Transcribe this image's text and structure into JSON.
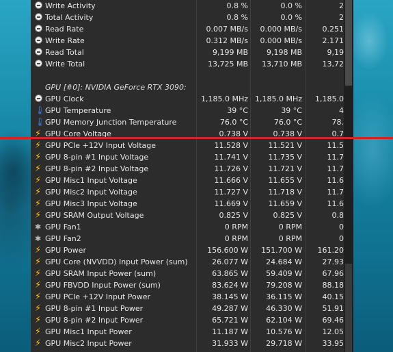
{
  "rows": [
    {
      "icon": "clock",
      "label": "Write Activity",
      "c1": "0.8 %",
      "c2": "0.0 %",
      "c3": "2"
    },
    {
      "icon": "clock",
      "label": "Total Activity",
      "c1": "0.8 %",
      "c2": "0.0 %",
      "c3": "2"
    },
    {
      "icon": "clock",
      "label": "Read Rate",
      "c1": "0.007 MB/s",
      "c2": "0.000 MB/s",
      "c3": "0.251"
    },
    {
      "icon": "clock",
      "label": "Write Rate",
      "c1": "0.312 MB/s",
      "c2": "0.000 MB/s",
      "c3": "2.171"
    },
    {
      "icon": "clock",
      "label": "Read Total",
      "c1": "9,199 MB",
      "c2": "9,198 MB",
      "c3": "9,19"
    },
    {
      "icon": "clock",
      "label": "Write Total",
      "c1": "13,725 MB",
      "c2": "13,710 MB",
      "c3": "13,72"
    },
    {
      "icon": "none",
      "label": "",
      "c1": "",
      "c2": "",
      "c3": ""
    },
    {
      "icon": "none",
      "label": "GPU [#0]: NVIDIA GeForce RTX 3090:",
      "c1": "",
      "c2": "",
      "c3": "",
      "section": true
    },
    {
      "icon": "clock",
      "label": "GPU Clock",
      "c1": "1,185.0 MHz",
      "c2": "1,185.0 MHz",
      "c3": "1,185.0"
    },
    {
      "icon": "therm",
      "label": "GPU Temperature",
      "c1": "39 °C",
      "c2": "39 °C",
      "c3": "4"
    },
    {
      "icon": "therm",
      "label": "GPU Memory Junction Temperature",
      "c1": "76.0 °C",
      "c2": "76.0 °C",
      "c3": "78."
    },
    {
      "icon": "bolt",
      "label": "GPU Core Voltage",
      "c1": "0.738 V",
      "c2": "0.738 V",
      "c3": "0.7"
    },
    {
      "icon": "bolt",
      "label": "GPU PCIe +12V Input Voltage",
      "c1": "11.528 V",
      "c2": "11.521 V",
      "c3": "11.5"
    },
    {
      "icon": "bolt",
      "label": "GPU 8-pin #1 Input Voltage",
      "c1": "11.741 V",
      "c2": "11.735 V",
      "c3": "11.7"
    },
    {
      "icon": "bolt",
      "label": "GPU 8-pin #2 Input Voltage",
      "c1": "11.726 V",
      "c2": "11.721 V",
      "c3": "11.7"
    },
    {
      "icon": "bolt",
      "label": "GPU Misc1 Input Voltage",
      "c1": "11.666 V",
      "c2": "11.655 V",
      "c3": "11.6"
    },
    {
      "icon": "bolt",
      "label": "GPU Misc2 Input Voltage",
      "c1": "11.727 V",
      "c2": "11.718 V",
      "c3": "11.7"
    },
    {
      "icon": "bolt",
      "label": "GPU Misc3 Input Voltage",
      "c1": "11.669 V",
      "c2": "11.659 V",
      "c3": "11.6"
    },
    {
      "icon": "bolt",
      "label": "GPU SRAM Output Voltage",
      "c1": "0.825 V",
      "c2": "0.825 V",
      "c3": "0.8"
    },
    {
      "icon": "fan",
      "label": "GPU Fan1",
      "c1": "0 RPM",
      "c2": "0 RPM",
      "c3": "0"
    },
    {
      "icon": "fan",
      "label": "GPU Fan2",
      "c1": "0 RPM",
      "c2": "0 RPM",
      "c3": "0"
    },
    {
      "icon": "bolt",
      "label": "GPU Power",
      "c1": "156.600 W",
      "c2": "151.700 W",
      "c3": "161.20"
    },
    {
      "icon": "bolt",
      "label": "GPU Core (NVVDD) Input Power (sum)",
      "c1": "26.077 W",
      "c2": "24.684 W",
      "c3": "27.93"
    },
    {
      "icon": "bolt",
      "label": "GPU SRAM Input Power (sum)",
      "c1": "63.865 W",
      "c2": "59.409 W",
      "c3": "67.96"
    },
    {
      "icon": "bolt",
      "label": "GPU FBVDD Input Power (sum)",
      "c1": "83.624 W",
      "c2": "79.208 W",
      "c3": "88.18"
    },
    {
      "icon": "bolt",
      "label": "GPU PCIe +12V Input Power",
      "c1": "38.145 W",
      "c2": "36.115 W",
      "c3": "40.15"
    },
    {
      "icon": "bolt",
      "label": "GPU 8-pin #1 Input Power",
      "c1": "49.287 W",
      "c2": "46.330 W",
      "c3": "51.91"
    },
    {
      "icon": "bolt",
      "label": "GPU 8-pin #2 Input Power",
      "c1": "65.721 W",
      "c2": "62.104 W",
      "c3": "69.46"
    },
    {
      "icon": "bolt",
      "label": "GPU Misc1 Input Power",
      "c1": "11.187 W",
      "c2": "10.576 W",
      "c3": "12.05"
    },
    {
      "icon": "bolt",
      "label": "GPU Misc2 Input Power",
      "c1": "31.933 W",
      "c2": "29.718 W",
      "c3": "33.95"
    }
  ],
  "colors": {
    "panel": "#2c2c2c",
    "text": "#e6e6e6",
    "bolt": "#ffc21a",
    "therm": "#3b7fd9",
    "marker": "#d6232a"
  }
}
